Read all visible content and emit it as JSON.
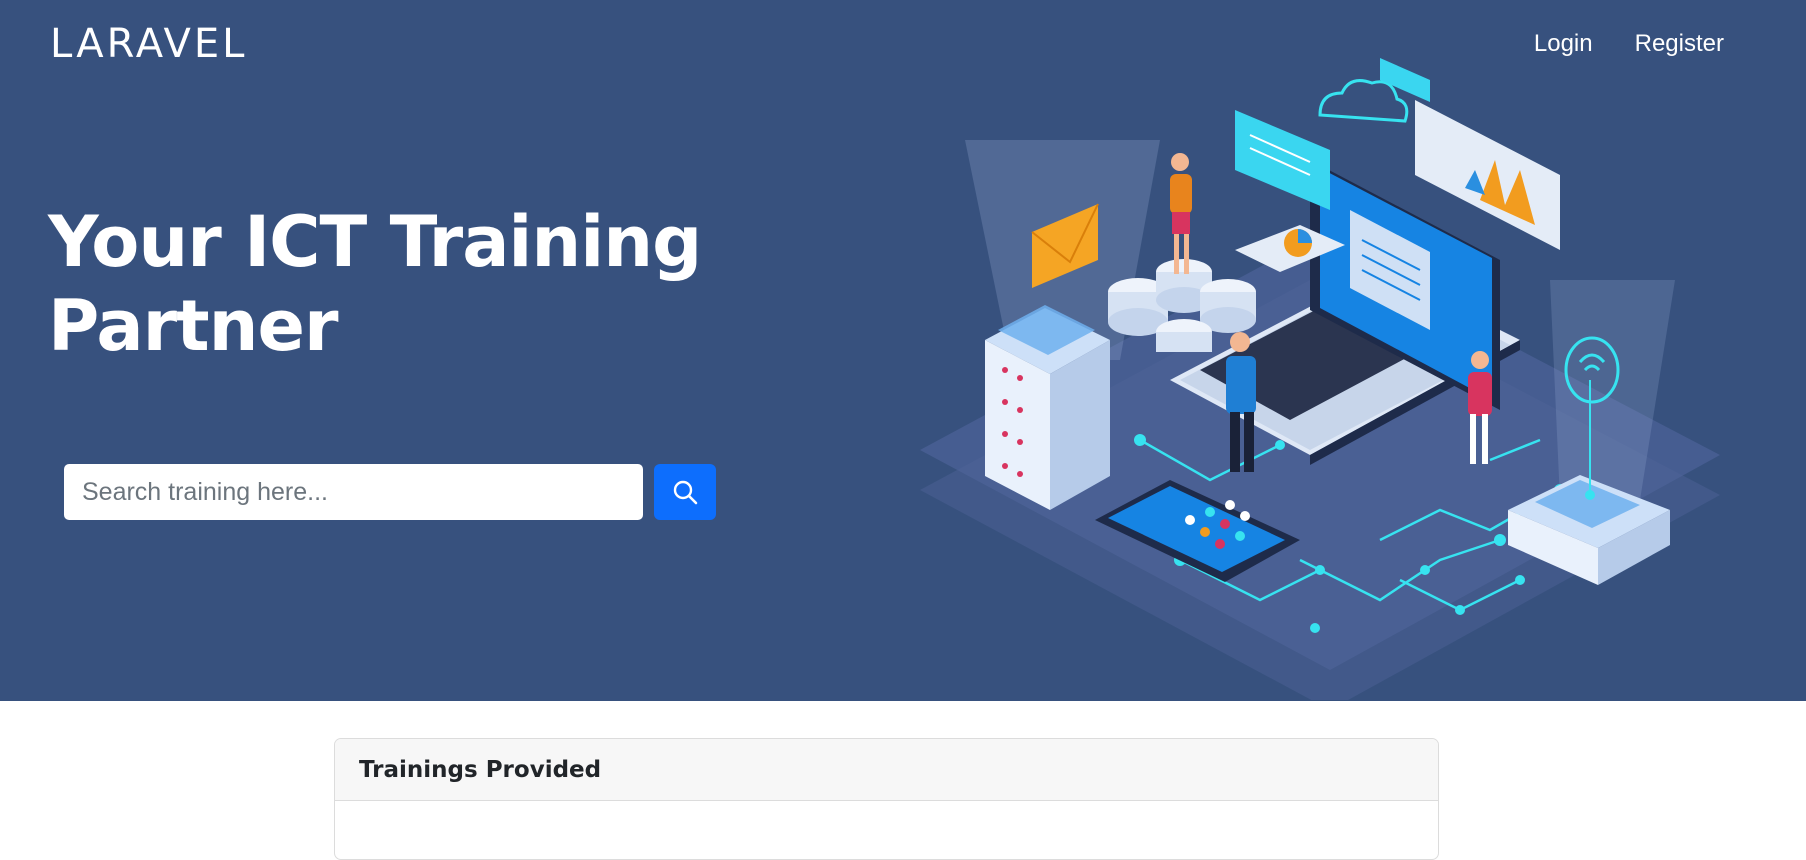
{
  "brand": {
    "logo": "LARAVEL"
  },
  "nav": {
    "login": "Login",
    "register": "Register"
  },
  "hero": {
    "headline": "Your ICT Training Partner",
    "search_placeholder": "Search training here...",
    "search_icon": "search-icon",
    "illustration": "isometric-ict-illustration"
  },
  "trainings": {
    "title": "Trainings Provided"
  },
  "colors": {
    "hero_bg": "#37517e",
    "search_button": "#0d6efd",
    "accent_cyan": "#37e3f0"
  }
}
